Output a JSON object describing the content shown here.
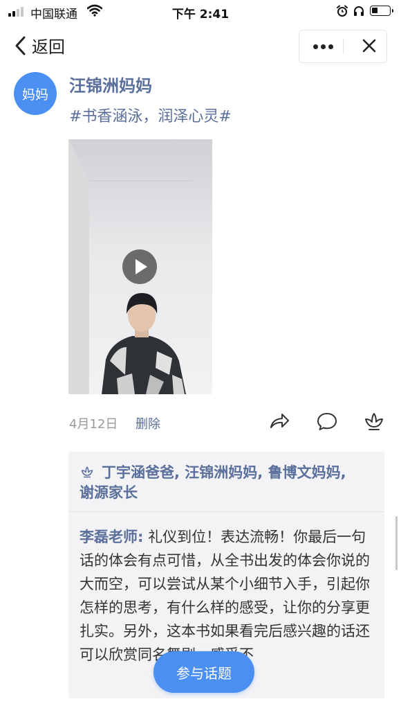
{
  "status_bar": {
    "carrier": "中国联通",
    "time": "下午 2:41",
    "battery_level": 0.35,
    "signal_bars": 2
  },
  "nav": {
    "back_label": "返回",
    "icons": [
      "chevron-left-icon",
      "more-dots-icon",
      "close-icon"
    ]
  },
  "post": {
    "avatar_text": "妈妈",
    "author": "汪锦洲妈妈",
    "topic": "#书香涵泳，润泽心灵#",
    "date": "4月12日",
    "delete_label": "删除",
    "actions": [
      "share-icon",
      "comment-icon",
      "like-flower-icon"
    ]
  },
  "likes": {
    "names": "丁宇涵爸爸, 汪锦洲妈妈, 鲁博文妈妈, 谢源家长"
  },
  "comments": [
    {
      "author": "李磊老师:",
      "text": "礼仪到位！表达流畅！你最后一句话的体会有点可惜，从全书出发的体会你说的大而空，可以尝试从某个小细节入手，引起你怎样的思考，有什么样的感受，让你的分享更扎实。另外，这本书如果看完后感兴趣的话还可以欣赏同名舞剧，感受不"
    }
  ],
  "join_button": "参与话题",
  "colors": {
    "accent": "#4b8ff2",
    "name_blue": "#5a6f9c",
    "comment_bg": "#f3f3f5"
  }
}
